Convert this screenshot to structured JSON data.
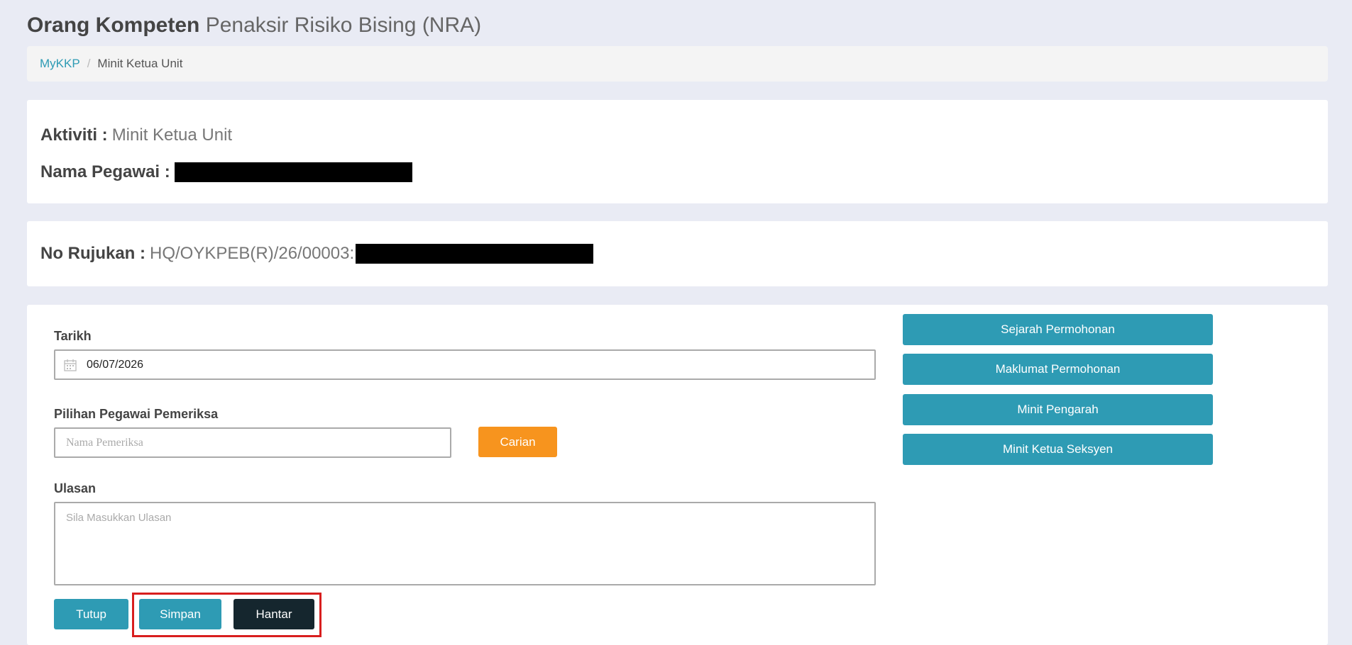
{
  "header": {
    "title_bold": "Orang Kompeten",
    "title_light": "Penaksir Risiko Bising (NRA)"
  },
  "breadcrumb": {
    "home": "MyKKP",
    "separator": "/",
    "current": "Minit Ketua Unit"
  },
  "info": {
    "aktiviti_label": "Aktiviti :",
    "aktiviti_value": "Minit Ketua Unit",
    "pegawai_label": "Nama Pegawai :",
    "rujukan_label": "No Rujukan :",
    "rujukan_value": "HQ/OYKPEB(R)/26/00003:"
  },
  "form": {
    "tarikh_label": "Tarikh",
    "tarikh_value": "06/07/2026",
    "pegawai_label": "Pilihan Pegawai Pemeriksa",
    "pegawai_placeholder": "Nama Pemeriksa",
    "carian_label": "Carian",
    "ulasan_label": "Ulasan",
    "ulasan_placeholder": "Sila Masukkan Ulasan"
  },
  "actions": {
    "tutup": "Tutup",
    "simpan": "Simpan",
    "hantar": "Hantar"
  },
  "side_buttons": [
    "Sejarah Permohonan",
    "Maklumat Permohonan",
    "Minit Pengarah",
    "Minit Ketua Seksyen"
  ],
  "colors": {
    "teal": "#2e9bb4",
    "orange": "#f7941e",
    "dark": "#15262e",
    "highlight": "#d81e1e"
  }
}
